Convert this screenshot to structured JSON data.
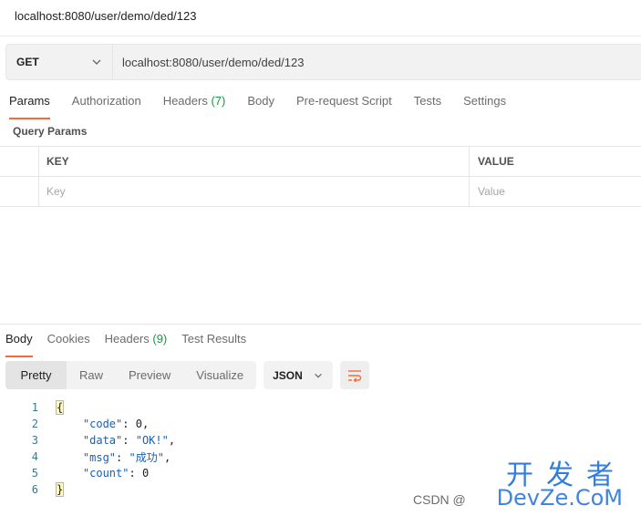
{
  "window": {
    "title": "localhost:8080/user/demo/ded/123"
  },
  "request": {
    "method": "GET",
    "url": "localhost:8080/user/demo/ded/123"
  },
  "request_tabs": [
    {
      "label": "Params",
      "count": "",
      "active": true
    },
    {
      "label": "Authorization",
      "count": ""
    },
    {
      "label": "Headers",
      "count": "(7)"
    },
    {
      "label": "Body",
      "count": ""
    },
    {
      "label": "Pre-request Script",
      "count": ""
    },
    {
      "label": "Tests",
      "count": ""
    },
    {
      "label": "Settings",
      "count": ""
    }
  ],
  "query_params": {
    "label": "Query Params",
    "key_header": "KEY",
    "value_header": "VALUE",
    "key_placeholder": "Key",
    "value_placeholder": "Value"
  },
  "response_tabs": [
    {
      "label": "Body",
      "count": "",
      "active": true
    },
    {
      "label": "Cookies",
      "count": ""
    },
    {
      "label": "Headers",
      "count": "(9)"
    },
    {
      "label": "Test Results",
      "count": ""
    }
  ],
  "view_modes": [
    "Pretty",
    "Raw",
    "Preview",
    "Visualize"
  ],
  "format": "JSON",
  "response_body": {
    "line_numbers": [
      "1",
      "2",
      "3",
      "4",
      "5",
      "6"
    ],
    "open": "{",
    "close": "}",
    "fields": [
      {
        "key": "\"code\"",
        "value": "0",
        "comma": ","
      },
      {
        "key": "\"data\"",
        "value": "\"OK!\"",
        "comma": ","
      },
      {
        "key": "\"msg\"",
        "value": "\"成功\"",
        "comma": ","
      },
      {
        "key": "\"count\"",
        "value": "0",
        "comma": ""
      }
    ]
  },
  "watermark": {
    "cn": "开发者",
    "csdn": "CSDN @",
    "en": "DevZe.CoM"
  },
  "colors": {
    "accent": "#f26b3a",
    "count_green": "#0b9e3a",
    "json_blue": "#1a5fb4"
  }
}
